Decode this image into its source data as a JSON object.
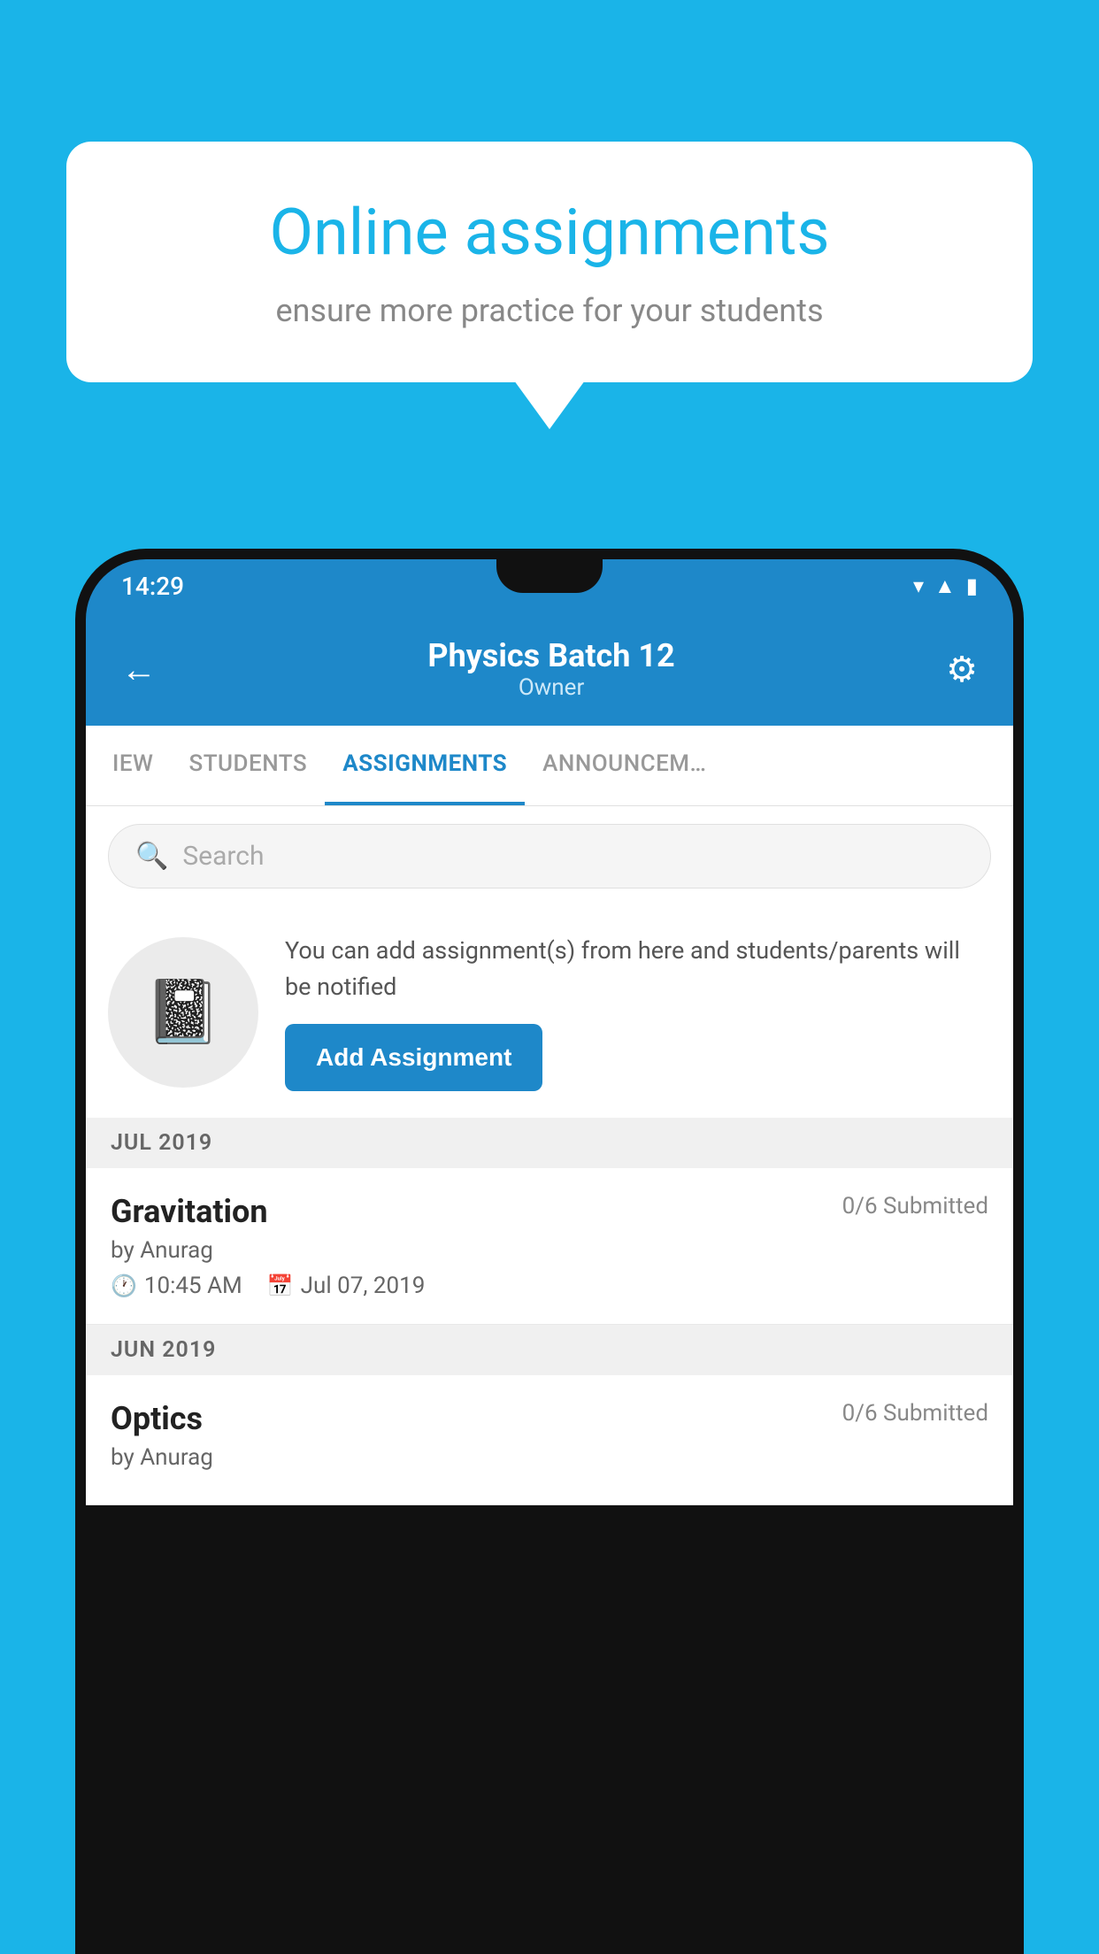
{
  "background": {
    "color": "#1ab4e8"
  },
  "speech_bubble": {
    "title": "Online assignments",
    "subtitle": "ensure more practice for your students"
  },
  "status_bar": {
    "time": "14:29",
    "icons": [
      "wifi",
      "signal",
      "battery"
    ]
  },
  "app_header": {
    "back_label": "←",
    "title": "Physics Batch 12",
    "subtitle": "Owner",
    "gear_label": "⚙"
  },
  "tabs": [
    {
      "label": "IEW",
      "active": false
    },
    {
      "label": "STUDENTS",
      "active": false
    },
    {
      "label": "ASSIGNMENTS",
      "active": true
    },
    {
      "label": "ANNOUNCEM…",
      "active": false
    }
  ],
  "search": {
    "placeholder": "Search"
  },
  "promo": {
    "description": "You can add assignment(s) from here and students/parents will be notified",
    "button_label": "Add Assignment"
  },
  "sections": [
    {
      "month": "JUL 2019",
      "assignments": [
        {
          "name": "Gravitation",
          "submitted": "0/6 Submitted",
          "by": "by Anurag",
          "time": "10:45 AM",
          "date": "Jul 07, 2019"
        }
      ]
    },
    {
      "month": "JUN 2019",
      "assignments": [
        {
          "name": "Optics",
          "submitted": "0/6 Submitted",
          "by": "by Anurag",
          "time": "",
          "date": ""
        }
      ]
    }
  ]
}
